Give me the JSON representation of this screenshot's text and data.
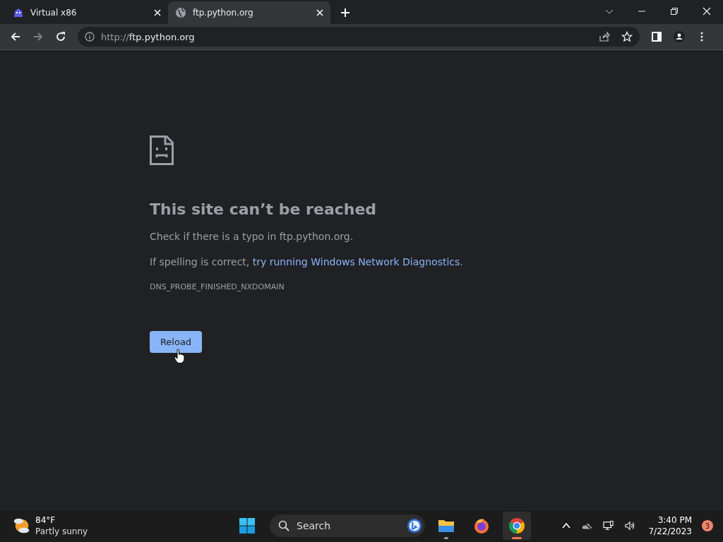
{
  "tabs": [
    {
      "title": "Virtual x86",
      "kind": "app",
      "selected": false
    },
    {
      "title": "ftp.python.org",
      "kind": "globe",
      "selected": true
    }
  ],
  "address_bar": {
    "scheme": "http://",
    "host": "ftp.python.org"
  },
  "error_page": {
    "heading": "This site can’t be reached",
    "line_1": "Check if there is a typo in ftp.python.org.",
    "line_2_prefix": "If spelling is correct, ",
    "line_2_link": "try running Windows Network Diagnostics",
    "line_2_suffix": ".",
    "error_code": "DNS_PROBE_FINISHED_NXDOMAIN",
    "button": "Reload"
  },
  "taskbar": {
    "weather": {
      "temperature": "84°F",
      "condition": "Partly sunny"
    },
    "search": {
      "placeholder": "Search"
    },
    "apps": [
      {
        "kind": "files",
        "running": true,
        "selected": false
      },
      {
        "kind": "firefox",
        "running": false,
        "selected": false
      },
      {
        "kind": "chrome",
        "running": true,
        "selected": true
      }
    ],
    "time": "3:40 PM",
    "date": "7/22/2023",
    "notifications": "3"
  }
}
